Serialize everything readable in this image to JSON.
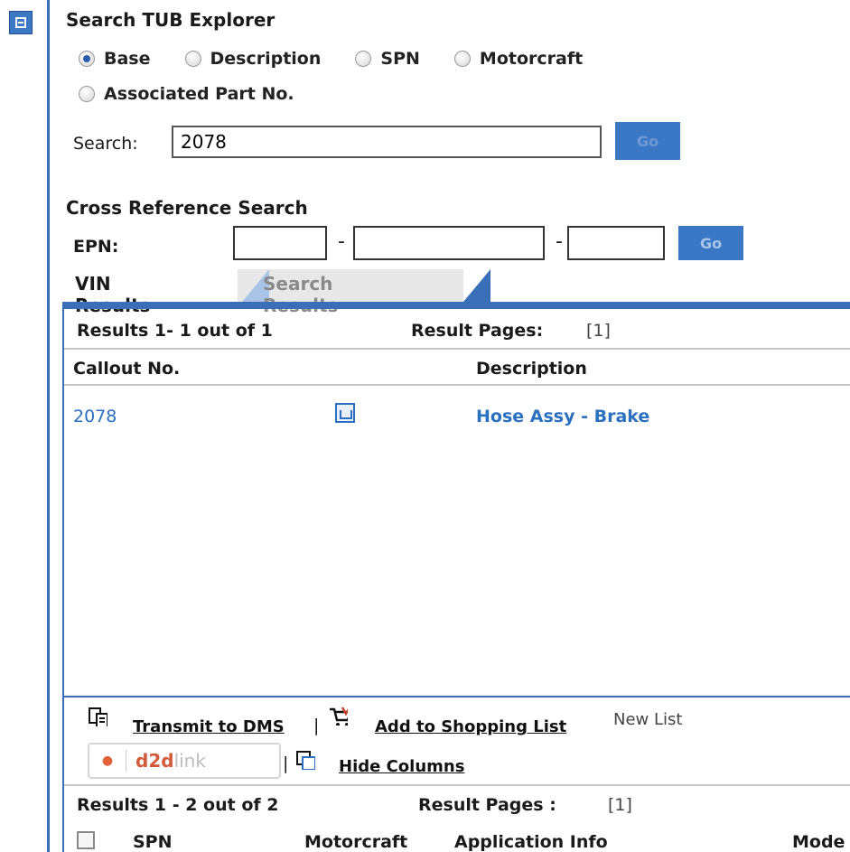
{
  "explorer": {
    "title": "Search TUB Explorer",
    "options": [
      "Base",
      "Description",
      "SPN",
      "Motorcraft",
      "Associated Part No."
    ],
    "selected": "Base",
    "search_label": "Search:",
    "search_value": "2078",
    "go_label": "Go"
  },
  "cross_ref": {
    "title": "Cross Reference Search",
    "epn_label": "EPN:",
    "go_label": "Go"
  },
  "tabs": {
    "vin": "VIN Results",
    "search": "Search Results"
  },
  "results_top": {
    "summary": "Results 1- 1 out of 1",
    "pages_label": "Result Pages:",
    "pages_value": "[1]",
    "col_callout": "Callout No.",
    "col_description": "Description",
    "rows": [
      {
        "callout": "2078",
        "description": "Hose Assy - Brake"
      }
    ]
  },
  "toolbar": {
    "transmit": "Transmit to DMS",
    "add_list": "Add to Shopping List",
    "list_select": "New List",
    "d2d_brand": "d2d",
    "d2d_suffix": "link",
    "hide_columns": "Hide Columns"
  },
  "results_bottom": {
    "summary": "Results 1 - 2 out of 2",
    "pages_label": "Result Pages :",
    "pages_value": "[1]",
    "columns": [
      "SPN",
      "Motorcraft",
      "Application Info",
      "Mode"
    ]
  },
  "colors": {
    "accent": "#3a6fb8",
    "link": "#2a6fc0",
    "button": "#3a78c6"
  }
}
